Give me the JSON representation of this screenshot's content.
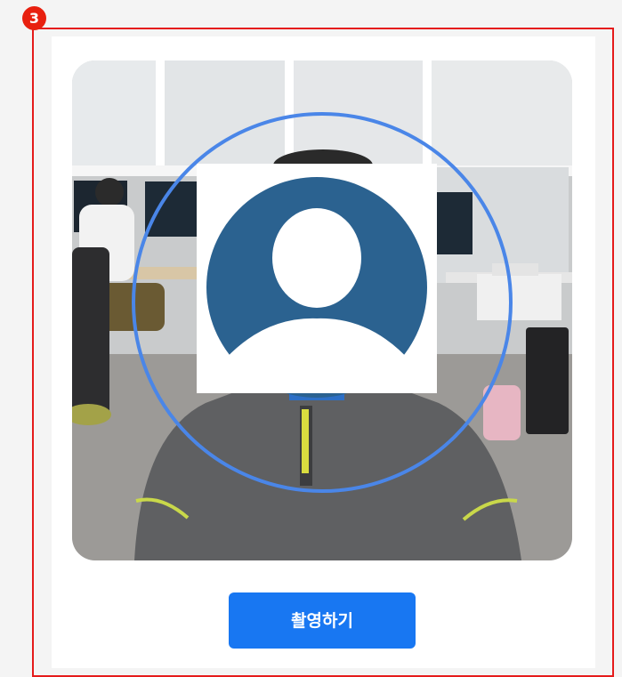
{
  "step": {
    "number": "3"
  },
  "camera": {
    "guide_circle_color": "#4a86e8",
    "avatar_color": "#2b6290",
    "placeholder_icon": "user-avatar-icon"
  },
  "actions": {
    "capture_label": "촬영하기"
  },
  "colors": {
    "highlight_border": "#e51b1b",
    "step_badge": "#e8200f",
    "button": "#1877f2"
  }
}
